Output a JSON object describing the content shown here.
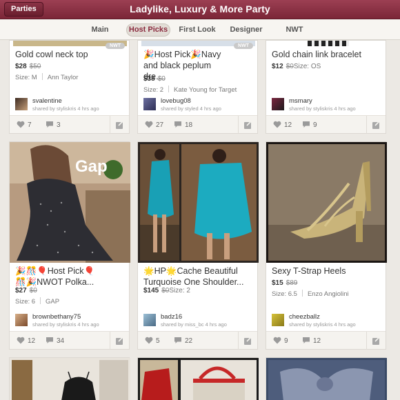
{
  "header": {
    "parties_label": "Parties",
    "title": "Ladylike, Luxury & More Party"
  },
  "tabs": [
    "Main",
    "Host Picks",
    "First Look",
    "Designer",
    "NWT"
  ],
  "active_tab": "Host Picks",
  "listings": [
    {
      "title": "Gold cowl neck top",
      "price": "$28",
      "orig_price": "$50",
      "size": "Size: M",
      "brand": "Ann Taylor",
      "badge": "NWT",
      "username": "svalentine",
      "shared": "shared by styliskris 4 hrs ago",
      "likes": "7",
      "comments": "3"
    },
    {
      "title": "🎉Host Pick🎉Navy and black peplum dre...",
      "price": "$38",
      "orig_price": "$0",
      "size": "Size: 2",
      "brand": "Kate Young for Target",
      "badge": "NWT",
      "username": "lovebug08",
      "shared": "shared by styled 4 hrs ago",
      "likes": "27",
      "comments": "18"
    },
    {
      "title": "Gold chain link bracelet",
      "price": "$12",
      "orig_price": "$0",
      "size": "Size: OS",
      "brand": "",
      "badge": "",
      "username": "msmary",
      "shared": "shared by styliskris 4 hrs ago",
      "likes": "12",
      "comments": "9"
    },
    {
      "title": "🎉🎊🎈Host Pick🎈🎊🎉NWOT Polka...",
      "price": "$27",
      "orig_price": "$0",
      "size": "Size: 6",
      "brand": "GAP",
      "badge": "",
      "photo_text": "Gap",
      "username": "brownbethany75",
      "shared": "shared by styliskris 4 hrs ago",
      "likes": "12",
      "comments": "34"
    },
    {
      "title": "🌟HP🌟Cache Beautiful Turquoise One Shoulder...",
      "price": "$145",
      "orig_price": "$0",
      "size": "Size: 2",
      "brand": "",
      "badge": "",
      "username": "badz16",
      "shared": "shared by miss_bc 4 hrs ago",
      "likes": "5",
      "comments": "22"
    },
    {
      "title": "Sexy T-Strap Heels",
      "price": "$15",
      "orig_price": "$89",
      "size": "Size: 6.5",
      "brand": "Enzo Angiolini",
      "badge": "",
      "username": "cheezballz",
      "shared": "shared by styliskris 4 hrs ago",
      "likes": "9",
      "comments": "12"
    }
  ],
  "colors": {
    "header": "#7b2637",
    "accent": "#8a2a3e",
    "background": "#ece9e4"
  }
}
